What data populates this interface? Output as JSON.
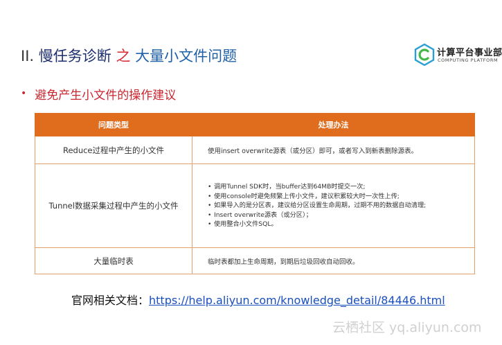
{
  "slide": {
    "title_roman": "II.",
    "title_part1": "慢任务诊断",
    "title_part2": "之",
    "title_part3": "大量小文件问题",
    "bullet": "避免产生小文件的操作建议",
    "logo_cn": "计算平台事业部",
    "logo_en": "COMPUTING PLATFORM",
    "logo_icon": "c-hexagon-logo-icon"
  },
  "table": {
    "headers": [
      "问题类型",
      "处理办法"
    ],
    "rows": [
      {
        "type": "Reduce过程中产生的小文件",
        "solution": "使用insert overwrite源表（或分区）即可，或者写入到新表删除源表。"
      },
      {
        "type": "Tunnel数据采集过程中产生的小文件",
        "points": [
          "调用Tunnel SDK时，当buffer达到64MB时提交一次;",
          "使用console时避免频繁上传小文件，建议积累较大时一次性上传;",
          "如果导入的是分区表，建议给分区设置生命周期，过期不用的数据自动清理;",
          "Insert overwrite源表（或分区）；",
          "使用整合小文件SQL。"
        ]
      },
      {
        "type": "大量临时表",
        "solution": "临时表都加上生命周期，到期后垃圾回收自动回收。"
      }
    ]
  },
  "doc": {
    "label": "官网相关文档：",
    "url": "https://help.aliyun.com/knowledge_detail/84446.html"
  },
  "watermark": "云栖社区 yq.aliyun.com",
  "colors": {
    "accent": "#d9262f",
    "header": "#e06d1d",
    "title_blue": "#1f5fa6",
    "link": "#1a4fbf"
  }
}
